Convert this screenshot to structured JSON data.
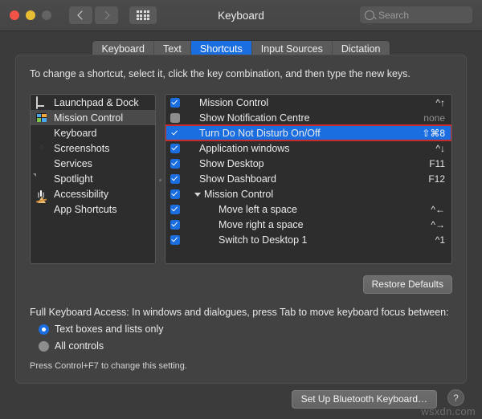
{
  "window": {
    "title": "Keyboard",
    "traffic_lights": [
      "close",
      "minimize",
      "zoom-disabled"
    ],
    "nav": {
      "back": "‹",
      "forward": "›",
      "grid": "show-all-icon"
    },
    "search": {
      "placeholder": "Search",
      "value": ""
    }
  },
  "tabs": [
    {
      "label": "Keyboard",
      "active": false
    },
    {
      "label": "Text",
      "active": false
    },
    {
      "label": "Shortcuts",
      "active": true
    },
    {
      "label": "Input Sources",
      "active": false
    },
    {
      "label": "Dictation",
      "active": false
    }
  ],
  "instruction": "To change a shortcut, select it, click the key combination, and then type the new keys.",
  "sidebar": {
    "items": [
      {
        "label": "Launchpad & Dock",
        "icon": "launchpad-icon",
        "selected": false
      },
      {
        "label": "Mission Control",
        "icon": "mission-control-icon",
        "selected": true
      },
      {
        "label": "Keyboard",
        "icon": "keyboard-icon",
        "selected": false
      },
      {
        "label": "Screenshots",
        "icon": "screenshots-icon",
        "selected": false
      },
      {
        "label": "Services",
        "icon": "services-gear-icon",
        "selected": false
      },
      {
        "label": "Spotlight",
        "icon": "spotlight-icon",
        "selected": false
      },
      {
        "label": "Accessibility",
        "icon": "accessibility-icon",
        "selected": false
      },
      {
        "label": "App Shortcuts",
        "icon": "app-shortcuts-icon",
        "selected": false
      }
    ]
  },
  "shortcuts": {
    "rows": [
      {
        "label": "Mission Control",
        "shortcut": "^↑",
        "checked": true,
        "selected": false,
        "indent": 0,
        "group": false
      },
      {
        "label": "Show Notification Centre",
        "shortcut": "none",
        "checked": false,
        "selected": false,
        "indent": 0,
        "group": false
      },
      {
        "label": "Turn Do Not Disturb On/Off",
        "shortcut": "⇧⌘8",
        "checked": true,
        "selected": true,
        "indent": 0,
        "group": false
      },
      {
        "label": "Application windows",
        "shortcut": "^↓",
        "checked": true,
        "selected": false,
        "indent": 0,
        "group": false
      },
      {
        "label": "Show Desktop",
        "shortcut": "F11",
        "checked": true,
        "selected": false,
        "indent": 0,
        "group": false
      },
      {
        "label": "Show Dashboard",
        "shortcut": "F12",
        "checked": true,
        "selected": false,
        "indent": 0,
        "group": false
      },
      {
        "label": "Mission Control",
        "shortcut": "",
        "checked": true,
        "selected": false,
        "indent": 0,
        "group": true
      },
      {
        "label": "Move left a space",
        "shortcut": "^←",
        "checked": true,
        "selected": false,
        "indent": 1,
        "group": false
      },
      {
        "label": "Move right a space",
        "shortcut": "^→",
        "checked": true,
        "selected": false,
        "indent": 1,
        "group": false
      },
      {
        "label": "Switch to Desktop 1",
        "shortcut": "^1",
        "checked": true,
        "selected": false,
        "indent": 1,
        "group": false
      }
    ]
  },
  "restore_defaults_label": "Restore Defaults",
  "full_keyboard_access": {
    "title": "Full Keyboard Access: In windows and dialogues, press Tab to move keyboard focus between:",
    "options": [
      {
        "label": "Text boxes and lists only",
        "selected": true
      },
      {
        "label": "All controls",
        "selected": false
      }
    ],
    "note": "Press Control+F7 to change this setting."
  },
  "bottom": {
    "bluetooth_button": "Set Up Bluetooth Keyboard…",
    "help_button": "?"
  },
  "watermark": "wsxdn.com",
  "colors": {
    "accent_blue": "#1a6ee0",
    "selection_outline_red": "#c52b2b",
    "window_bg": "#3b3b3b",
    "panel_bg": "#424242",
    "list_bg": "#2d2d2d"
  }
}
